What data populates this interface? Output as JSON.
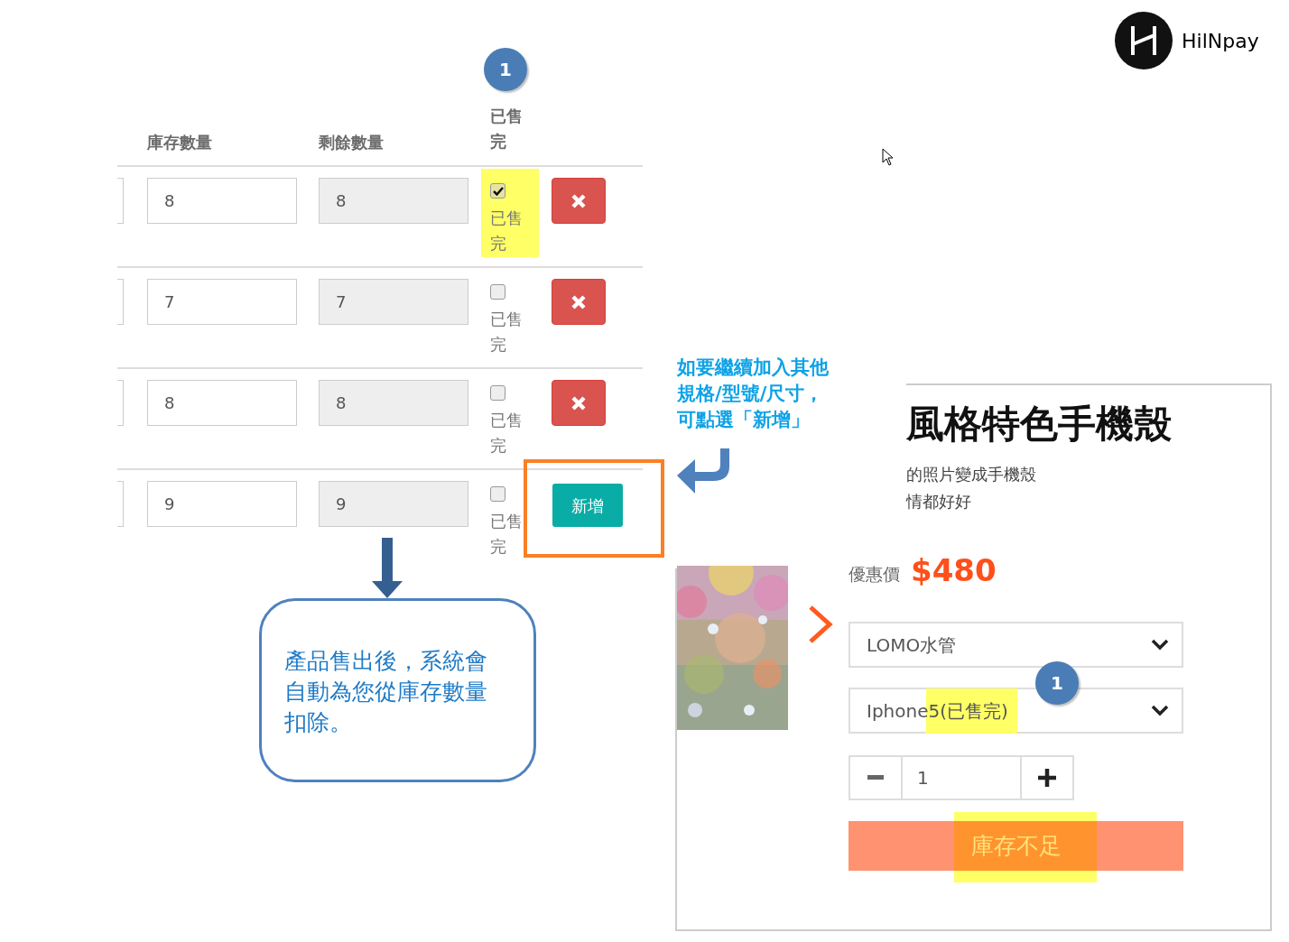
{
  "logo": {
    "text": "HilNpay"
  },
  "stock_table": {
    "badge": "1",
    "columns": [
      {
        "label": "庫存數量"
      },
      {
        "label": "剩餘數量"
      },
      {
        "label": "已售完"
      }
    ],
    "rows": [
      {
        "stock": "8",
        "remaining": "8",
        "sold_out_label": "已售完",
        "sold_out": true,
        "highlighted": true,
        "action": {
          "kind": "delete"
        }
      },
      {
        "stock": "7",
        "remaining": "7",
        "sold_out_label": "已售完",
        "sold_out": false,
        "highlighted": false,
        "action": {
          "kind": "delete"
        }
      },
      {
        "stock": "8",
        "remaining": "8",
        "sold_out_label": "已售完",
        "sold_out": false,
        "highlighted": false,
        "action": {
          "kind": "delete"
        }
      },
      {
        "stock": "9",
        "remaining": "9",
        "sold_out_label": "已售完",
        "sold_out": false,
        "highlighted": false,
        "action": {
          "kind": "add",
          "label": "新增"
        }
      }
    ]
  },
  "callout": {
    "text": "產品售出後，系統會自動為您從庫存數量扣除。"
  },
  "add_hint": {
    "lines": [
      "如要繼續加入其他",
      "規格/型號/尺寸，",
      "可點選「新增」"
    ]
  },
  "product": {
    "title": "風格特色手機殼",
    "description": [
      "的照片變成手機殼",
      "情都好好"
    ],
    "price_label": "優惠價",
    "price": "$480",
    "options": [
      {
        "value": "LOMO水管",
        "highlighted": false
      },
      {
        "value": "Iphone5(已售完)",
        "highlighted": true
      }
    ],
    "badge": "1",
    "quantity": "1",
    "button": "庫存不足"
  }
}
